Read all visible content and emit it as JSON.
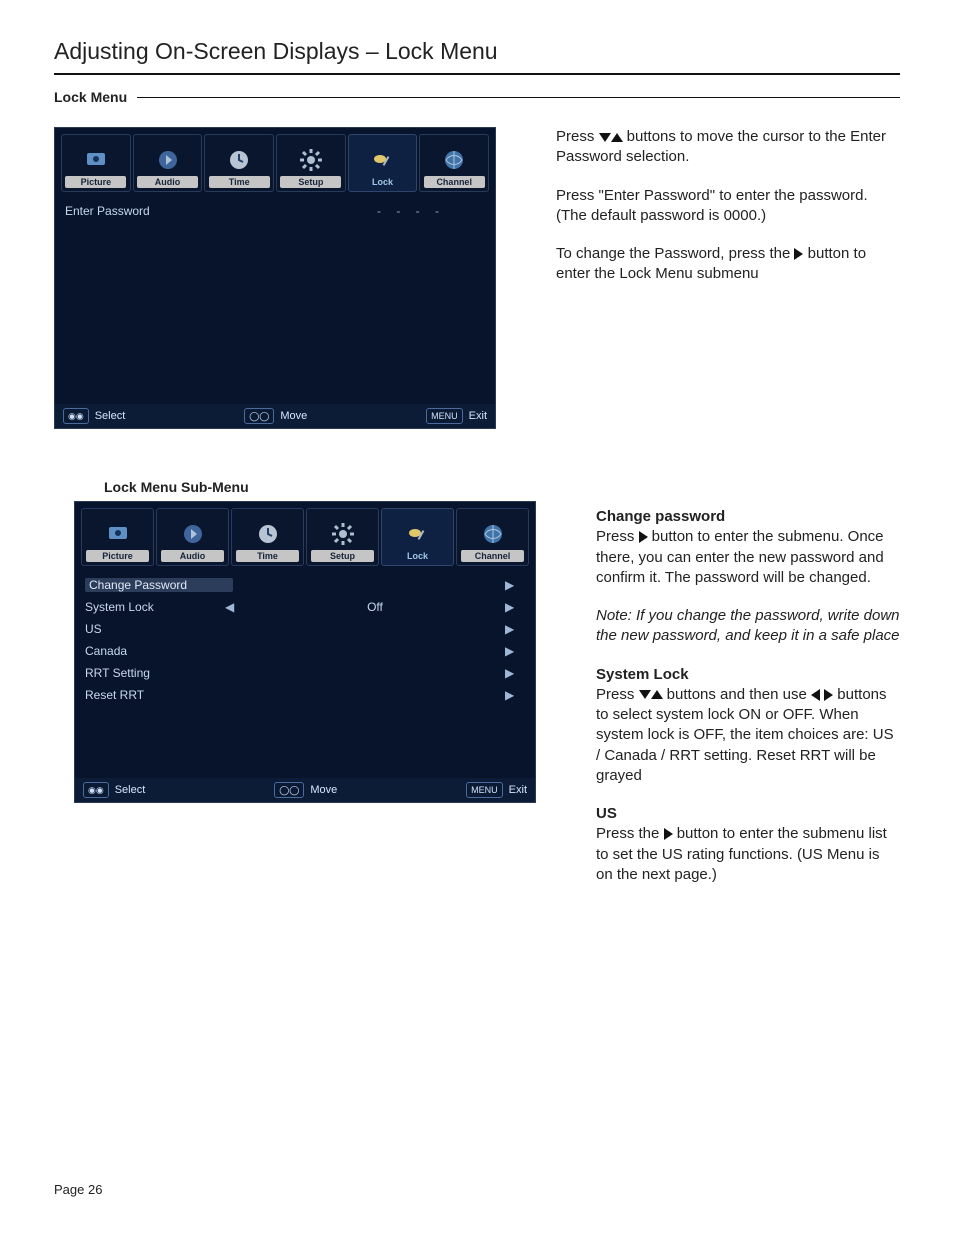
{
  "page_title": "Adjusting On-Screen Displays – Lock Menu",
  "section_heading": "Lock Menu",
  "page_number": "Page 26",
  "osd1": {
    "tabs": [
      "Picture",
      "Audio",
      "Time",
      "Setup",
      "Lock",
      "Channel"
    ],
    "selected_tab": "Lock",
    "row_label": "Enter  Password",
    "password_dashes": "-  -  -  -",
    "footer": {
      "select": "Select",
      "move": "Move",
      "menu": "MENU",
      "exit": "Exit"
    }
  },
  "instructions1": {
    "p1a": "Press ",
    "p1b": " buttons to move the cursor to the Enter Password selection.",
    "p2": "Press \"Enter Password\" to enter the password. (The default password is 0000.)",
    "p3a": "To change the Password, press the ",
    "p3b": " button to enter the Lock  Menu submenu"
  },
  "caption2": "Lock Menu Sub-Menu",
  "osd2": {
    "tabs": [
      "Picture",
      "Audio",
      "Time",
      "Setup",
      "Lock",
      "Channel"
    ],
    "selected_tab": "Lock",
    "items": [
      {
        "label": "Change Password",
        "value": "",
        "left": "",
        "right": "▶",
        "highlight": true
      },
      {
        "label": "System Lock",
        "value": "Off",
        "left": "◀",
        "right": "▶"
      },
      {
        "label": "US",
        "value": "",
        "left": "",
        "right": "▶"
      },
      {
        "label": "Canada",
        "value": "",
        "left": "",
        "right": "▶"
      },
      {
        "label": "RRT Setting",
        "value": "",
        "left": "",
        "right": "▶"
      },
      {
        "label": "Reset RRT",
        "value": "",
        "left": "",
        "right": "▶"
      }
    ],
    "footer": {
      "select": "Select",
      "move": "Move",
      "menu": "MENU",
      "exit": "Exit"
    }
  },
  "instructions2": {
    "h1": "Change password",
    "t1a": "Press ",
    "t1b": " button to enter the submenu. Once there, you can enter the new password and confirm it. The password will be changed.",
    "note": "Note: If you change the password, write down the new password, and keep it in a safe place",
    "h2": "System Lock",
    "t2a": "Press ",
    "t2b": " buttons and then use ",
    "t2c": " buttons to select system lock ON or OFF. When system lock is OFF, the item choices are:  US / Canada / RRT setting.  Reset RRT will be grayed",
    "h3": "US",
    "t3a": "Press the ",
    "t3b": " button to enter the submenu list to set the US rating functions. (US Menu is on the next page.)"
  }
}
